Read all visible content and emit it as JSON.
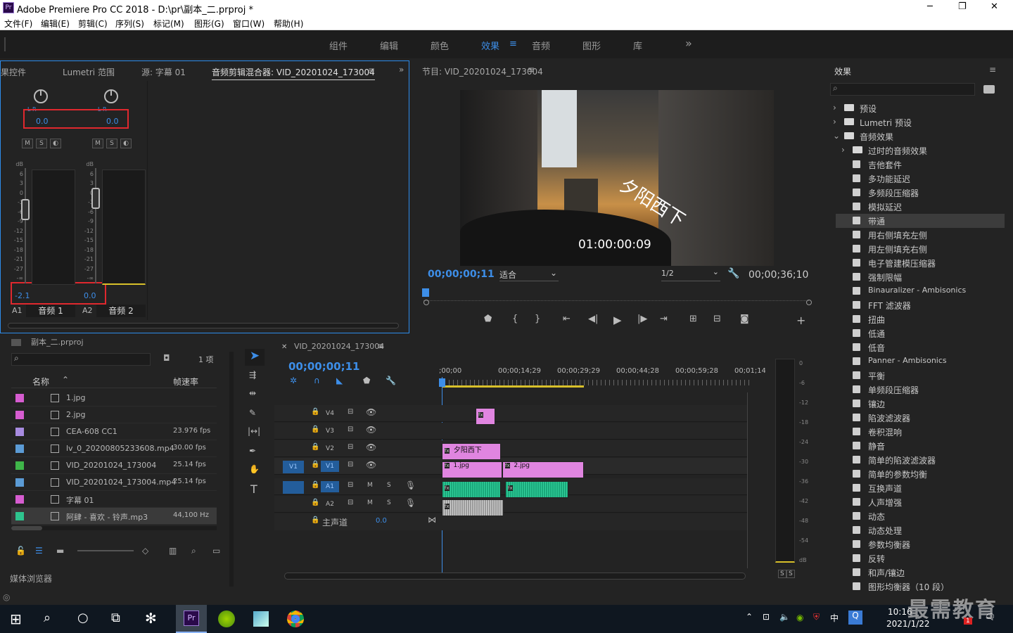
{
  "window": {
    "title": "Adobe Premiere Pro CC 2018 - D:\\pr\\副本_二.prproj *",
    "min": "─",
    "max": "❐",
    "close": "✕"
  },
  "menu": [
    "文件(F)",
    "编辑(E)",
    "剪辑(C)",
    "序列(S)",
    "标记(M)",
    "图形(G)",
    "窗口(W)",
    "帮助(H)"
  ],
  "workspaces": [
    "组件",
    "编辑",
    "颜色",
    "效果",
    "音频",
    "图形",
    "库"
  ],
  "workspace_active": "效果",
  "workspace_more": "»",
  "source_panel": {
    "tabs": [
      "效果控件",
      "Lumetri 范围",
      "源: 字幕 01",
      "音频剪辑混合器: VID_20201024_173004"
    ],
    "channels": [
      {
        "pan": "0.0",
        "lr": "L      R",
        "level": "-2.1",
        "id": "A1",
        "name": "音频 1"
      },
      {
        "pan": "0.0",
        "lr": "L      R",
        "level": "0.0",
        "id": "A2",
        "name": "音频 2"
      }
    ],
    "msb": [
      "M",
      "S",
      "◐"
    ],
    "db_scale": [
      "dB",
      "6",
      "3",
      "0",
      "-3",
      "-6",
      "-9",
      "-12",
      "-15",
      "-18",
      "-21",
      "-27",
      "-∞"
    ]
  },
  "program": {
    "title": "节目: VID_20201024_173004",
    "overlay_text": "夕阳西下",
    "overlay_tc": "01:00:00:09",
    "timecode": "00;00;00;11",
    "fit": "适合",
    "quality": "1/2",
    "duration": "00;00;36;10"
  },
  "project": {
    "title": "副本_二.prproj",
    "count": "1 项",
    "col_name": "名称",
    "col_rate": "帧速率",
    "items": [
      {
        "name": "1.jpg",
        "rate": "",
        "color": "#d65cd0"
      },
      {
        "name": "2.jpg",
        "rate": "",
        "color": "#d65cd0"
      },
      {
        "name": "CEA-608 CC1",
        "rate": "23.976 fps",
        "color": "#a78be0"
      },
      {
        "name": "lv_0_20200805233608.mp4",
        "rate": "30.00 fps",
        "color": "#5b9bd5"
      },
      {
        "name": "VID_20201024_173004",
        "rate": "25.14 fps",
        "color": "#3fb549"
      },
      {
        "name": "VID_20201024_173004.mp4",
        "rate": "25.14 fps",
        "color": "#5b9bd5"
      },
      {
        "name": "字幕 01",
        "rate": "",
        "color": "#d65cd0"
      },
      {
        "name": "阿肆 - 喜欢 - 铃声.mp3",
        "rate": "44,100 Hz",
        "color": "#2ec48e"
      }
    ],
    "media_browser": "媒体浏览器"
  },
  "timeline": {
    "tab": "VID_20201024_173004",
    "timecode": "00;00;00;11",
    "ruler": [
      ";00;00",
      "00;00;14;29",
      "00;00;29;29",
      "00;00;44;28",
      "00;00;59;28",
      "00;01;14"
    ],
    "tracks": [
      "V4",
      "V3",
      "V2",
      "V1",
      "A1",
      "A2"
    ],
    "master": "主声道",
    "master_val": "0.0",
    "clips": {
      "v2": "夕阳西下",
      "v1a": "1.jpg",
      "v1b": "2.jpg",
      "fx": "fx"
    }
  },
  "meter_scale": [
    "0",
    "-6",
    "-12",
    "-18",
    "-24",
    "-30",
    "-36",
    "-42",
    "-48",
    "-54",
    "dB"
  ],
  "meter_ss": [
    "S",
    "S"
  ],
  "effects": {
    "title": "效果",
    "items": [
      {
        "label": "预设",
        "level": 0,
        "type": "folder",
        "arrow": "›"
      },
      {
        "label": "Lumetri 预设",
        "level": 0,
        "type": "folder",
        "arrow": "›"
      },
      {
        "label": "音频效果",
        "level": 0,
        "type": "folder",
        "arrow": "⌄"
      },
      {
        "label": "过时的音频效果",
        "level": 1,
        "type": "folder",
        "arrow": "›"
      },
      {
        "label": "吉他套件",
        "level": 1,
        "type": "fx"
      },
      {
        "label": "多功能延迟",
        "level": 1,
        "type": "fx"
      },
      {
        "label": "多频段压缩器",
        "level": 1,
        "type": "fx"
      },
      {
        "label": "模拟延迟",
        "level": 1,
        "type": "fx"
      },
      {
        "label": "带通",
        "level": 1,
        "type": "fx",
        "selected": true
      },
      {
        "label": "用右侧填充左侧",
        "level": 1,
        "type": "fx"
      },
      {
        "label": "用左侧填充右侧",
        "level": 1,
        "type": "fx"
      },
      {
        "label": "电子管建模压缩器",
        "level": 1,
        "type": "fx"
      },
      {
        "label": "强制限幅",
        "level": 1,
        "type": "fx"
      },
      {
        "label": "Binauralizer - Ambisonics",
        "level": 1,
        "type": "fx"
      },
      {
        "label": "FFT 滤波器",
        "level": 1,
        "type": "fx"
      },
      {
        "label": "扭曲",
        "level": 1,
        "type": "fx"
      },
      {
        "label": "低通",
        "level": 1,
        "type": "fx"
      },
      {
        "label": "低音",
        "level": 1,
        "type": "fx"
      },
      {
        "label": "Panner - Ambisonics",
        "level": 1,
        "type": "fx"
      },
      {
        "label": "平衡",
        "level": 1,
        "type": "fx"
      },
      {
        "label": "单频段压缩器",
        "level": 1,
        "type": "fx"
      },
      {
        "label": "镶边",
        "level": 1,
        "type": "fx"
      },
      {
        "label": "陷波滤波器",
        "level": 1,
        "type": "fx"
      },
      {
        "label": "卷积混响",
        "level": 1,
        "type": "fx"
      },
      {
        "label": "静音",
        "level": 1,
        "type": "fx"
      },
      {
        "label": "简单的陷波滤波器",
        "level": 1,
        "type": "fx"
      },
      {
        "label": "简单的参数均衡",
        "level": 1,
        "type": "fx"
      },
      {
        "label": "互换声道",
        "level": 1,
        "type": "fx"
      },
      {
        "label": "人声增强",
        "level": 1,
        "type": "fx"
      },
      {
        "label": "动态",
        "level": 1,
        "type": "fx"
      },
      {
        "label": "动态处理",
        "level": 1,
        "type": "fx"
      },
      {
        "label": "参数均衡器",
        "level": 1,
        "type": "fx"
      },
      {
        "label": "反转",
        "level": 1,
        "type": "fx"
      },
      {
        "label": "和声/镶边",
        "level": 1,
        "type": "fx"
      },
      {
        "label": "图形均衡器（10 段）",
        "level": 1,
        "type": "fx"
      }
    ]
  },
  "taskbar": {
    "time": "10:16",
    "date": "2021/1/22",
    "ime": "中",
    "watermark": "最需教育",
    "badge": "1"
  }
}
